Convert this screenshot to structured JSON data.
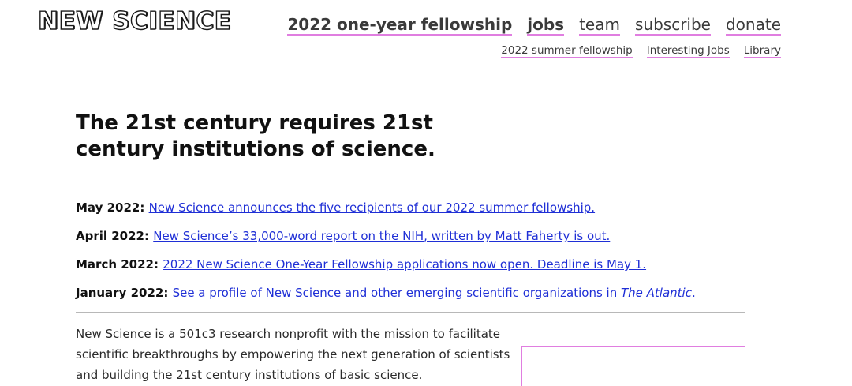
{
  "header": {
    "logo": "NEW SCIENCE",
    "nav_main": [
      {
        "label": "2022 one-year fellowship",
        "bold": true
      },
      {
        "label": "jobs",
        "bold": true
      },
      {
        "label": "team",
        "bold": false
      },
      {
        "label": "subscribe",
        "bold": false
      },
      {
        "label": "donate",
        "bold": false
      }
    ],
    "nav_sub": [
      {
        "label": "2022 summer fellowship"
      },
      {
        "label": "Interesting Jobs"
      },
      {
        "label": "Library"
      }
    ]
  },
  "main": {
    "headline": "The 21st century requires 21st century institutions of science.",
    "news": [
      {
        "date": "May 2022",
        "sep": ": ",
        "text": "New Science announces the five recipients of our 2022 summer fellowship.",
        "em": "",
        "tail": ""
      },
      {
        "date": "April 2022",
        "sep": ": ",
        "text": "New Science’s 33,000-word report on the NIH, written by Matt Faherty is out.",
        "em": "",
        "tail": ""
      },
      {
        "date": "March 2022",
        "sep": ": ",
        "text": "2022 New Science One-Year Fellowship applications now open. Deadline is May 1.",
        "em": "",
        "tail": ""
      },
      {
        "date": "January 2022",
        "sep": ": ",
        "text": "See a profile of New Science and other emerging scientific organizations in ",
        "em": "The Atlantic",
        "tail": "."
      }
    ],
    "intro": "New Science is a 501c3 research nonprofit with the mission to facilitate scientific breakthroughs by empowering the next generation of scientists and building the 21st century institutions of basic science."
  },
  "colors": {
    "link": "#1f2fd6",
    "nav_underline": "#e07ee0",
    "rule": "#b8b8b8"
  }
}
